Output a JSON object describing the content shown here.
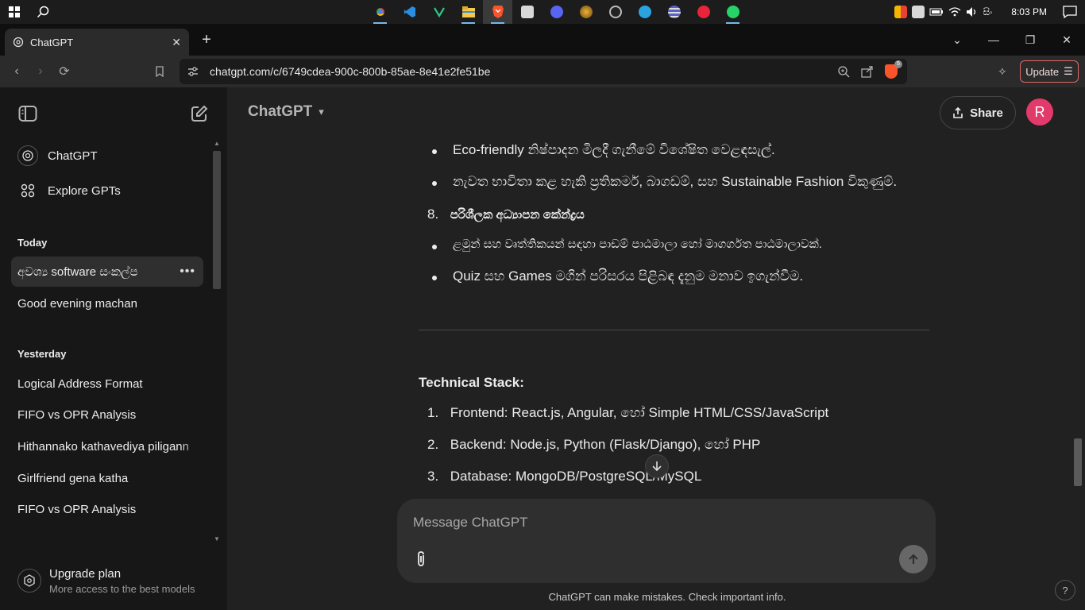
{
  "taskbar": {
    "time": "8:03 PM",
    "lang": "සිං",
    "apps": [
      "chrome-icon",
      "vscode-icon",
      "visual-studio-icon",
      "file-explorer-icon",
      "brave-icon",
      "app-icon",
      "discord-icon",
      "app-icon",
      "app-icon",
      "telegram-icon",
      "app-icon",
      "app-icon",
      "whatsapp-icon"
    ]
  },
  "browser": {
    "tab_title": "ChatGPT",
    "url": "chatgpt.com/c/6749cdea-900c-800b-85ae-8e41e2fe51be",
    "brave_badge": "5",
    "update_label": "Update"
  },
  "sidebar": {
    "nav": [
      {
        "label": "ChatGPT"
      },
      {
        "label": "Explore GPTs"
      }
    ],
    "today_heading": "Today",
    "today": [
      {
        "label": "අවශ්‍ය software සංකල්ප",
        "active": true
      },
      {
        "label": "Good evening machan"
      }
    ],
    "yesterday_heading": "Yesterday",
    "yesterday": [
      {
        "label": "Logical Address Format"
      },
      {
        "label": "FIFO vs OPR Analysis"
      },
      {
        "label": "Hithannako kathavediya piligann"
      },
      {
        "label": "Girlfriend gena katha"
      },
      {
        "label": "FIFO vs OPR Analysis"
      }
    ],
    "upgrade_title": "Upgrade plan",
    "upgrade_sub": "More access to the best models"
  },
  "header": {
    "model": "ChatGPT",
    "share_label": "Share",
    "avatar_initial": "R"
  },
  "conversation": {
    "bullets_top": [
      "Eco-friendly නිෂ්පාදන මිලදී ගැනීමේ විශේෂිත වෙළඳසැල්.",
      "නැවත භාවිතා කළ හැකි ප්‍රතිකමර්, බාගඩම්, සහ Sustainable Fashion විකුණුම්."
    ],
    "item8_num": "8.",
    "item8_title": "පරිශීලක අධ්‍යාපන කේන්ද්‍රය",
    "bullets_item8": [
      "ළමුන් සහ වෘත්තිකයන් සඳහා පාඩම් පාඨමාලා හෝ මාගර්ගත පාඨමාලාවක්.",
      "Quiz සහ Games මගින් පරිසරය පිළිබඳ දැනුම මනාව ඉගැන්වීම."
    ],
    "section_title": "Technical Stack:",
    "stack": [
      {
        "num": "1.",
        "text": "Frontend: React.js, Angular, හෝ Simple HTML/CSS/JavaScript"
      },
      {
        "num": "2.",
        "text": "Backend: Node.js, Python (Flask/Django), හෝ PHP"
      },
      {
        "num": "3.",
        "text": "Database: MongoDB/PostgreSQL/MySQL"
      }
    ]
  },
  "composer": {
    "placeholder": "Message ChatGPT",
    "disclaimer": "ChatGPT can make mistakes. Check important info.",
    "help": "?"
  },
  "colors": {
    "accent_avatar": "#e23a6b",
    "brave": "#fb542b",
    "update_border": "#e06868"
  }
}
